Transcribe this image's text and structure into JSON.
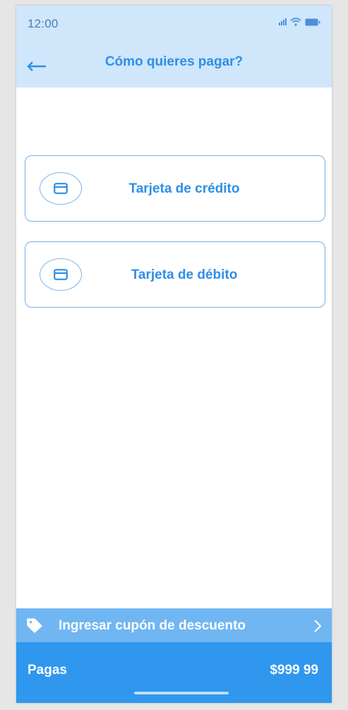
{
  "status_bar": {
    "time": "12:00",
    "icons": [
      "signal-icon",
      "wifi-icon",
      "battery-icon"
    ]
  },
  "header": {
    "back_icon": "arrow-left-icon",
    "title": "Cómo quieres pagar?"
  },
  "payment_options": [
    {
      "label": "Tarjeta de crédito",
      "icon": "credit-card-icon"
    },
    {
      "label": "Tarjeta de débito",
      "icon": "credit-card-icon"
    }
  ],
  "coupon": {
    "icon": "tag-icon",
    "label": "Ingresar cupón de descuento",
    "chevron": "chevron-right-icon"
  },
  "footer": {
    "label": "Pagas",
    "amount": "$999 99"
  },
  "colors": {
    "header_bg": "#cfe6fb",
    "accent": "#2e8fe6",
    "coupon_bg": "#6fb6f2",
    "footer_bg": "#2f97ee",
    "border": "#73b1ea"
  }
}
